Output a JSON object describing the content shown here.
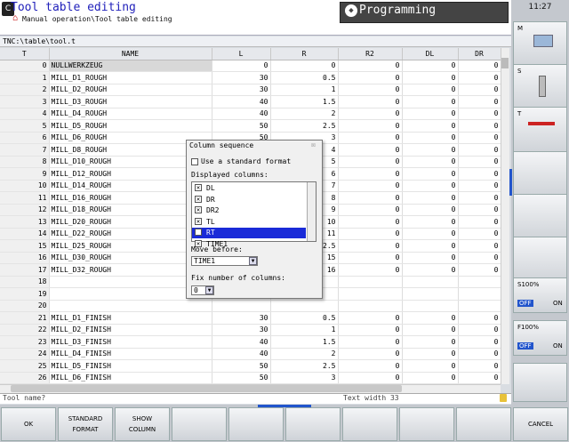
{
  "header": {
    "title": "Tool table editing",
    "subtitle": "Manual operation\\Tool table editing",
    "mode": "Programming",
    "clock": "11:27"
  },
  "path": "TNC:\\table\\tool.t",
  "table": {
    "columns": [
      "T",
      "NAME",
      "L",
      "R",
      "R2",
      "DL",
      "DR"
    ],
    "rows": [
      [
        "0",
        "NULLWERKZEUG",
        "0",
        "0",
        "0",
        "0",
        "0"
      ],
      [
        "1",
        "MILL_D1_ROUGH",
        "30",
        "0.5",
        "0",
        "0",
        "0"
      ],
      [
        "2",
        "MILL_D2_ROUGH",
        "30",
        "1",
        "0",
        "0",
        "0"
      ],
      [
        "3",
        "MILL_D3_ROUGH",
        "40",
        "1.5",
        "0",
        "0",
        "0"
      ],
      [
        "4",
        "MILL_D4_ROUGH",
        "40",
        "2",
        "0",
        "0",
        "0"
      ],
      [
        "5",
        "MILL_D5_ROUGH",
        "50",
        "2.5",
        "0",
        "0",
        "0"
      ],
      [
        "6",
        "MILL_D6_ROUGH",
        "50",
        "3",
        "0",
        "0",
        "0"
      ],
      [
        "7",
        "MILL_D8_ROUGH",
        "",
        "4",
        "0",
        "0",
        "0"
      ],
      [
        "8",
        "MILL_D10_ROUGH",
        "",
        "5",
        "0",
        "0",
        "0"
      ],
      [
        "9",
        "MILL_D12_ROUGH",
        "",
        "6",
        "0",
        "0",
        "0"
      ],
      [
        "10",
        "MILL_D14_ROUGH",
        "",
        "7",
        "0",
        "0",
        "0"
      ],
      [
        "11",
        "MILL_D16_ROUGH",
        "",
        "8",
        "0",
        "0",
        "0"
      ],
      [
        "12",
        "MILL_D18_ROUGH",
        "",
        "9",
        "0",
        "0",
        "0"
      ],
      [
        "13",
        "MILL_D20_ROUGH",
        "",
        "10",
        "0",
        "0",
        "0"
      ],
      [
        "14",
        "MILL_D22_ROUGH",
        "",
        "11",
        "0",
        "0",
        "0"
      ],
      [
        "15",
        "MILL_D25_ROUGH",
        "",
        "2.5",
        "0",
        "0",
        "0"
      ],
      [
        "16",
        "MILL_D30_ROUGH",
        "",
        "15",
        "0",
        "0",
        "0"
      ],
      [
        "17",
        "MILL_D32_ROUGH",
        "",
        "16",
        "0",
        "0",
        "0"
      ],
      [
        "18",
        "",
        "",
        "",
        "",
        "",
        ""
      ],
      [
        "19",
        "",
        "",
        "",
        "",
        "",
        ""
      ],
      [
        "20",
        "",
        "",
        "",
        "",
        "",
        ""
      ],
      [
        "21",
        "MILL_D1_FINISH",
        "30",
        "0.5",
        "0",
        "0",
        "0"
      ],
      [
        "22",
        "MILL_D2_FINISH",
        "30",
        "1",
        "0",
        "0",
        "0"
      ],
      [
        "23",
        "MILL_D3_FINISH",
        "40",
        "1.5",
        "0",
        "0",
        "0"
      ],
      [
        "24",
        "MILL_D4_FINISH",
        "40",
        "2",
        "0",
        "0",
        "0"
      ],
      [
        "25",
        "MILL_D5_FINISH",
        "50",
        "2.5",
        "0",
        "0",
        "0"
      ],
      [
        "26",
        "MILL_D6_FINISH",
        "50",
        "3",
        "0",
        "0",
        "0"
      ]
    ]
  },
  "status": {
    "left": "Tool name?",
    "right": "Text width 33"
  },
  "dialog": {
    "title": "Column sequence",
    "close": "☒",
    "standard_format": "Use a standard format",
    "displayed_label": "Displayed columns:",
    "columns": [
      {
        "label": "DL",
        "checked": true
      },
      {
        "label": "DR",
        "checked": true
      },
      {
        "label": "DR2",
        "checked": true
      },
      {
        "label": "TL",
        "checked": true
      },
      {
        "label": "RT",
        "checked": false
      },
      {
        "label": "TIME1",
        "checked": true
      }
    ],
    "move_before_label": "Move before:",
    "move_before_value": "TIME1",
    "fix_label": "Fix number of columns:",
    "fix_value": "0"
  },
  "softkeys": {
    "ok": "OK",
    "standard_format": "STANDARD\nFORMAT",
    "show_column": "SHOW\nCOLUMN",
    "cancel": "CANCEL"
  },
  "right_keys": {
    "m": "M",
    "s": "S",
    "t": "T",
    "s_override": "S100%",
    "f_override": "F100%",
    "off": "OFF",
    "on": "ON"
  }
}
